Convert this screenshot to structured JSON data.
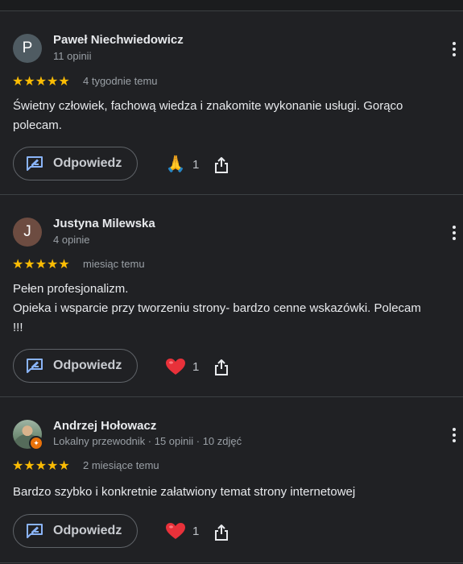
{
  "reviews": [
    {
      "avatar_letter": "P",
      "avatar_color": "#4f5b62",
      "name": "Paweł Niechwiedowicz",
      "meta": "11 opinii",
      "stars": "★★★★★",
      "when": "4 tygodnie temu",
      "text": "Świetny człowiek, fachową wiedza i znakomite wykonanie usługi. Gorąco\npolecam.",
      "reply_label": "Odpowiedz",
      "reaction_emoji": "🙏",
      "reaction_count": "1"
    },
    {
      "avatar_letter": "J",
      "avatar_color": "#6d4c41",
      "name": "Justyna Milewska",
      "meta": "4 opinie",
      "stars": "★★★★★",
      "when": "miesiąc temu",
      "text": "Pełen profesjonalizm.\nOpieka i wsparcie przy tworzeniu strony- bardzo cenne wskazówki. Polecam\n!!!",
      "reply_label": "Odpowiedz",
      "reaction_emoji": "heart",
      "reaction_count": "1"
    },
    {
      "avatar_letter": "",
      "avatar_color": "#6f8b74",
      "name": "Andrzej Hołowacz",
      "meta": "Lokalny przewodnik · 15 opinii · 10 zdjęć",
      "stars": "★★★★★",
      "when": "2 miesiące temu",
      "text": "Bardzo szybko i konkretnie załatwiony temat strony internetowej",
      "reply_label": "Odpowiedz",
      "reaction_emoji": "heart",
      "reaction_count": "1"
    }
  ],
  "colors": {
    "background": "#202124",
    "star": "#fbbc04",
    "reply_icon": "#8ab4f8",
    "heart": "#e8313a",
    "local_guide_badge": "#e8710a"
  },
  "icons": {
    "reply": "reply-edit-icon",
    "share": "share-icon",
    "more": "more-vert-icon"
  }
}
